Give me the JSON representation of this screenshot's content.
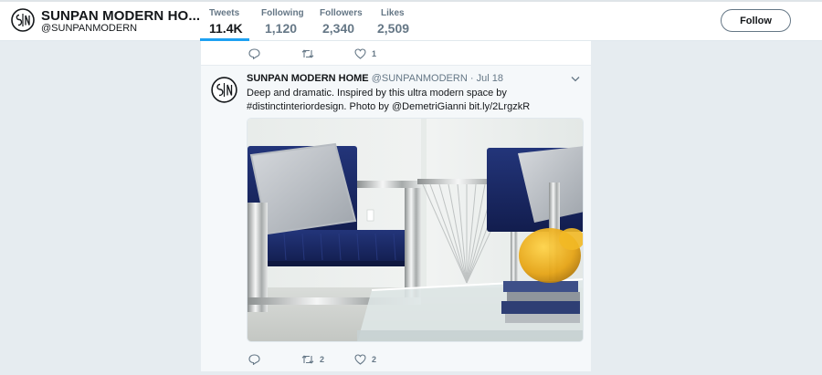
{
  "profile": {
    "name": "SUNPAN MODERN HO...",
    "handle": "@SUNPANMODERN"
  },
  "stats": [
    {
      "label": "Tweets",
      "value": "11.4K",
      "active": true
    },
    {
      "label": "Following",
      "value": "1,120",
      "active": false
    },
    {
      "label": "Followers",
      "value": "2,340",
      "active": false
    },
    {
      "label": "Likes",
      "value": "2,509",
      "active": false
    }
  ],
  "follow_label": "Follow",
  "previous_tweet": {
    "actions": {
      "reply_icon": "reply-icon",
      "retweet_icon": "retweet-icon",
      "like_icon": "heart-icon",
      "like_count": "1"
    }
  },
  "tweet": {
    "name": "SUNPAN MODERN HOME",
    "handle": "@SUNPANMODERN",
    "separator": "·",
    "date": "Jul 18",
    "text_line1": "Deep and dramatic. Inspired by this ultra modern space by",
    "text_line2": "#distinctinteriordesign. Photo by @DemetriGianni bit.ly/2LrgzkR",
    "retweet_count": "2",
    "like_count": "2"
  },
  "colors": {
    "accent": "#1da1f2",
    "text_secondary": "#657786",
    "page_bg": "#e6ecf0",
    "velvet_blue": "#1a2a66"
  }
}
